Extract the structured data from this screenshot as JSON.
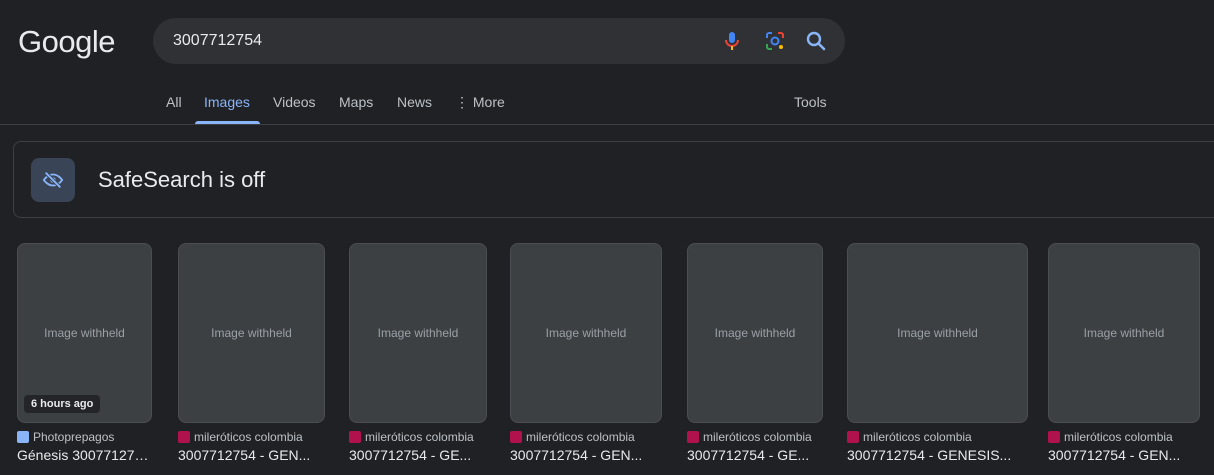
{
  "header": {
    "logo": "Google"
  },
  "search": {
    "query": "3007712754"
  },
  "tabs": [
    "All",
    "Images",
    "Videos",
    "Maps",
    "News",
    "More"
  ],
  "tools_label": "Tools",
  "safesearch": {
    "text": "SafeSearch is off"
  },
  "placeholder_label": "Image withheld",
  "results": [
    {
      "badge": "6 hours ago",
      "source": "Photoprepagos",
      "title": "Génesis 300771275..."
    },
    {
      "source": "mileróticos colombia",
      "title": "3007712754 - GEN..."
    },
    {
      "source": "mileróticos colombia",
      "title": "3007712754 - GE..."
    },
    {
      "source": "mileróticos colombia",
      "title": "3007712754 - GEN..."
    },
    {
      "source": "mileróticos colombia",
      "title": "3007712754 - GE..."
    },
    {
      "source": "mileróticos colombia",
      "title": "3007712754 - GENESIS..."
    },
    {
      "source": "mileróticos colombia",
      "title": "3007712754 - GEN..."
    }
  ],
  "colors": {
    "background": "#202124",
    "accent": "#8ab4f8",
    "favicon_photoprepagos": "#8ab4f8",
    "favicon_milero": "#b0124e"
  }
}
